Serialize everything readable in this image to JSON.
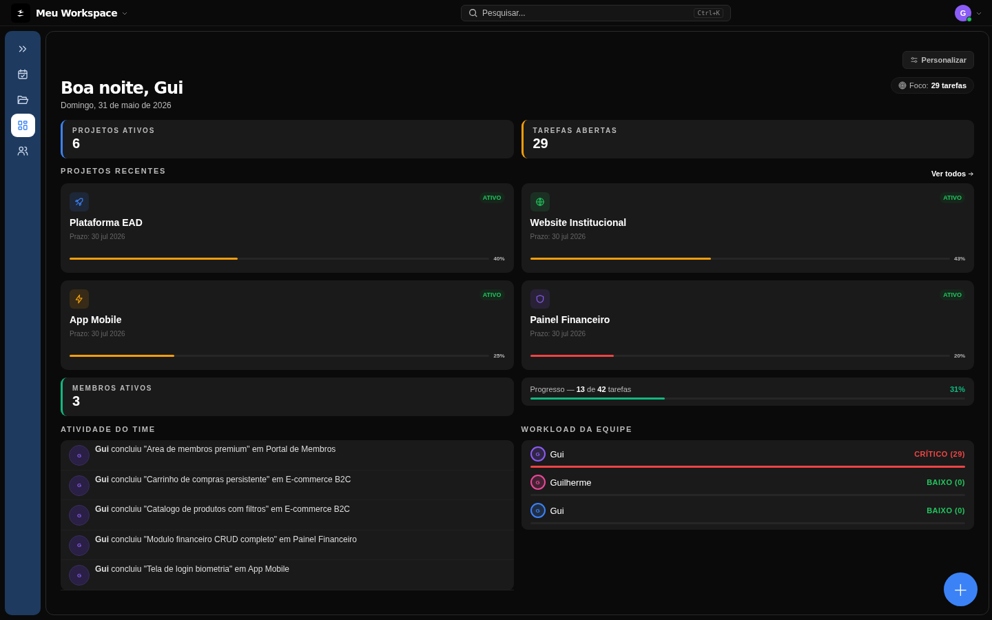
{
  "topbar": {
    "workspace": "Meu Workspace",
    "search_placeholder": "Pesquisar...",
    "shortcut": "Ctrl+K",
    "avatar": "G",
    "online": true
  },
  "sidebar": {
    "items": [
      {
        "selected": false
      },
      {
        "selected": false
      },
      {
        "selected": false
      },
      {
        "selected": true
      },
      {
        "selected": false
      }
    ]
  },
  "header": {
    "title": "Boa noite, Gui",
    "date": "Domingo, 31 de maio de 2026",
    "customize": "Personalizar",
    "focus_label": "Foco:",
    "focus_value": "29 tarefas"
  },
  "stats": [
    {
      "label": "PROJETOS ATIVOS",
      "value": "6",
      "color": "#3b82f6"
    },
    {
      "label": "TAREFAS ABERTAS",
      "value": "29",
      "color": "#f59e0b"
    }
  ],
  "recent": {
    "title": "PROJETOS RECENTES",
    "link": "Ver todos"
  },
  "projects": [
    {
      "name": "Plataforma EAD",
      "deadline": "Prazo: 30 jul 2026",
      "status": "ATIVO",
      "color": "#3b82f6",
      "level": 0.4,
      "percent": "40%"
    },
    {
      "name": "Website Institucional",
      "deadline": "Prazo: 30 jul 2026",
      "status": "ATIVO",
      "color": "#22c55e",
      "level": 0.43,
      "percent": "43%"
    },
    {
      "name": "App Mobile",
      "deadline": "Prazo: 30 jul 2026",
      "status": "ATIVO",
      "color": "#f59e0b",
      "level": 0.25,
      "percent": "25%"
    },
    {
      "name": "Painel Financeiro",
      "deadline": "Prazo: 30 jul 2026",
      "status": "ATIVO",
      "color": "#8b5cf6",
      "level": 0.2,
      "percent": "20%"
    }
  ],
  "members_stat": {
    "label": "MEMBROS ATIVOS",
    "value": "3",
    "color": "#10b981"
  },
  "progress": {
    "text": "Progresso — **13** de **42** tarefas",
    "percent": "31%",
    "level": 0.31
  },
  "activity": {
    "title": "ATIVIDADE DO TIME",
    "items": [
      {
        "avatar": "G",
        "text": "**Gui** concluiu \"Area de membros premium\" em Portal de Membros"
      },
      {
        "avatar": "G",
        "text": "**Gui** concluiu \"Carrinho de compras persistente\" em E-commerce B2C"
      },
      {
        "avatar": "G",
        "text": "**Gui** concluiu \"Catalogo de produtos com filtros\" em E-commerce B2C"
      },
      {
        "avatar": "G",
        "text": "**Gui** concluiu \"Modulo financeiro CRUD completo\" em Painel Financeiro"
      },
      {
        "avatar": "G",
        "text": "**Gui** concluiu \"Tela de login biometria\" em App Mobile"
      }
    ]
  },
  "workload": {
    "title": "WORKLOAD DA EQUIPE",
    "members": [
      {
        "avatar": "G",
        "name": "Gui",
        "status": "CRÍTICO (29)",
        "kind": "critical",
        "level": 1,
        "color": "#8b5cf6"
      },
      {
        "avatar": "G",
        "name": "Guilherme",
        "status": "BAIXO (0)",
        "kind": "low",
        "color": "#ec4899"
      },
      {
        "avatar": "G",
        "name": "Gui",
        "status": "BAIXO (0)",
        "kind": "low",
        "color": "#3b82f6"
      }
    ]
  },
  "fab": "+"
}
